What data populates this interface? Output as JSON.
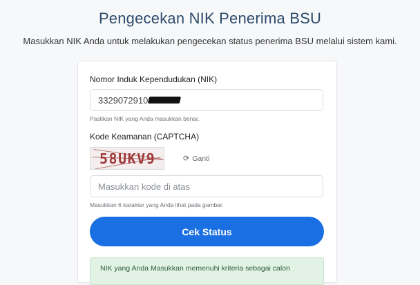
{
  "header": {
    "title": "Pengecekan NIK Penerima BSU",
    "subtitle": "Masukkan NIK Anda untuk melakukan pengecekan status penerima BSU melalui sistem kami."
  },
  "form": {
    "nik": {
      "label": "Nomor Induk Kependudukan (NIK)",
      "value": "3329072910",
      "hint": "Pastikan NIK yang Anda masukkan benar."
    },
    "captcha": {
      "label": "Kode Keamanan (CAPTCHA)",
      "code": "58UKV9",
      "refresh_label": "Ganti",
      "refresh_icon": "refresh-icon",
      "placeholder": "Masukkan kode di atas",
      "hint": "Masukkan 6 karakter yang Anda lihat pada gambar."
    },
    "submit_label": "Cek Status"
  },
  "result": {
    "message": "NIK yang Anda Masukkan memenuhi kriteria sebagai calon"
  },
  "colors": {
    "primary": "#1a6fe3",
    "title": "#2c4a6b",
    "success_bg": "#e2f3e6"
  }
}
